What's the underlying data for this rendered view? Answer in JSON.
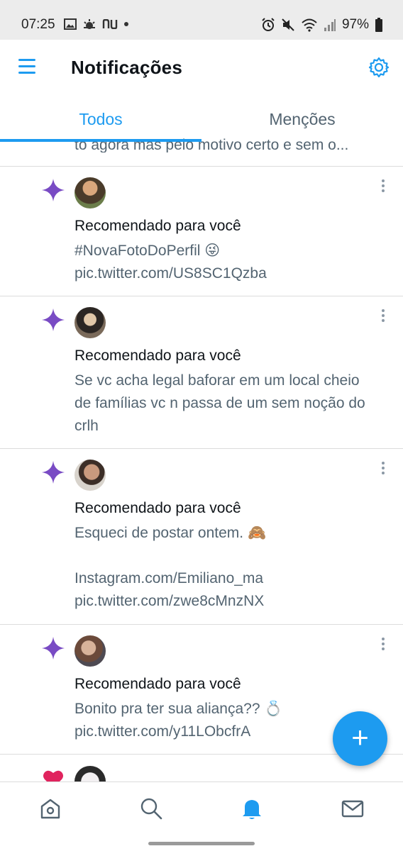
{
  "status_bar": {
    "time": "07:25",
    "battery": "97%",
    "left_icons": [
      "gallery-icon",
      "weather-icon",
      "nu-icon"
    ],
    "right_icons": [
      "alarm-icon",
      "mute-icon",
      "wifi-icon",
      "signal-icon",
      "battery-icon"
    ]
  },
  "header": {
    "title": "Notificações"
  },
  "tabs": [
    {
      "label": "Todos",
      "active": true
    },
    {
      "label": "Menções",
      "active": false
    }
  ],
  "partial_text": "to agora mas pelo motivo certo e sem o...",
  "notifications": [
    {
      "type": "recommendation",
      "icon": "sparkle-icon",
      "heading": "Recomendado para você",
      "text": "#NovaFotoDoPerfil 😜\npic.twitter.com/US8SC1Qzba"
    },
    {
      "type": "recommendation",
      "icon": "sparkle-icon",
      "heading": "Recomendado para você",
      "text": "Se vc acha legal baforar em um local cheio de famílias vc n passa de um sem noção do crlh"
    },
    {
      "type": "recommendation",
      "icon": "sparkle-icon",
      "heading": "Recomendado para você",
      "text": "Esqueci de postar ontem. 🙈\n\nInstagram.com/Emiliano_ma\npic.twitter.com/zwe8cMnzNX"
    },
    {
      "type": "recommendation",
      "icon": "sparkle-icon",
      "heading": "Recomendado para você",
      "text": "Bonito pra ter sua aliança?? 💍\npic.twitter.com/y11LObcfrA"
    },
    {
      "type": "like",
      "icon": "heart-icon"
    }
  ],
  "fab": {
    "label": "+"
  },
  "bottom_nav": [
    "home-icon",
    "search-icon",
    "notifications-icon",
    "messages-icon"
  ],
  "colors": {
    "accent": "#1d9bf0",
    "sparkle": "#794bc4",
    "heart": "#e0245e",
    "secondary_text": "#536471"
  }
}
